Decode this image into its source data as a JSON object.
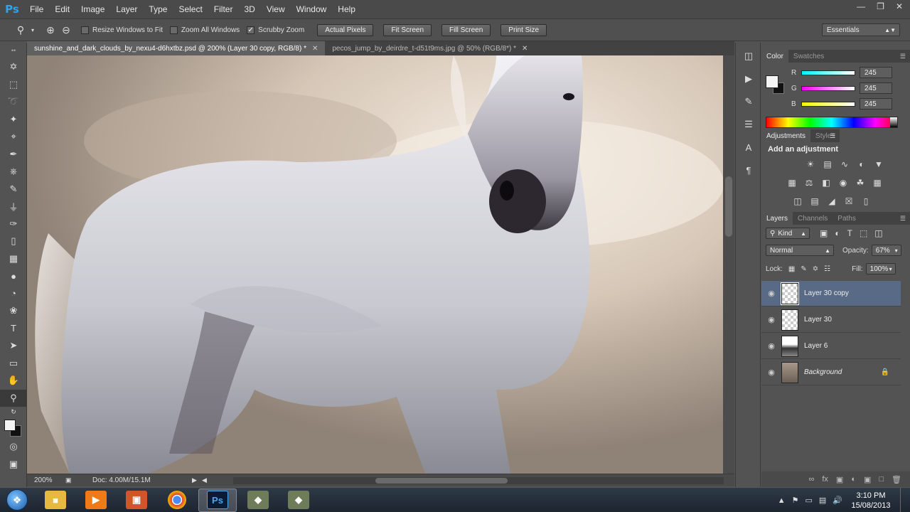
{
  "app": {
    "logo": "Ps"
  },
  "menu": [
    "File",
    "Edit",
    "Image",
    "Layer",
    "Type",
    "Select",
    "Filter",
    "3D",
    "View",
    "Window",
    "Help"
  ],
  "window_controls": [
    "minimize-icon",
    "restore-icon",
    "close-icon"
  ],
  "options": {
    "resize_windows": {
      "label": "Resize Windows to Fit",
      "checked": false
    },
    "zoom_all": {
      "label": "Zoom All Windows",
      "checked": false
    },
    "scrubby": {
      "label": "Scrubby Zoom",
      "checked": true
    },
    "buttons": [
      "Actual Pixels",
      "Fit Screen",
      "Fill Screen",
      "Print Size"
    ],
    "workspace": "Essentials"
  },
  "tabs": [
    {
      "title": "sunshine_and_dark_clouds_by_nexu4-d6hxtbz.psd @ 200% (Layer 30 copy, RGB/8) *",
      "active": true
    },
    {
      "title": "pecos_jump_by_deirdre_t-d51t9ms.jpg @ 50% (RGB/8*) *",
      "active": false
    }
  ],
  "status": {
    "zoom": "200%",
    "doc": "Doc: 4.00M/15.1M"
  },
  "color_panel": {
    "tabs": [
      "Color",
      "Swatches"
    ],
    "channels": [
      {
        "label": "R",
        "value": "245",
        "gradient": "#00ffff"
      },
      {
        "label": "G",
        "value": "245",
        "gradient": "#ff00ff"
      },
      {
        "label": "B",
        "value": "245",
        "gradient": "#ffff00"
      }
    ],
    "foreground": "#f5f5f5",
    "background": "#111111"
  },
  "adjustments_panel": {
    "tabs": [
      "Adjustments",
      "Styles"
    ],
    "title": "Add an adjustment"
  },
  "layers_panel": {
    "tabs": [
      "Layers",
      "Channels",
      "Paths"
    ],
    "filter": "Kind",
    "blend_mode": "Normal",
    "opacity_label": "Opacity:",
    "opacity": "67%",
    "lock_label": "Lock:",
    "fill_label": "Fill:",
    "fill": "100%",
    "layers": [
      {
        "name": "Layer 30 copy",
        "active": true,
        "locked": false,
        "italic": false
      },
      {
        "name": "Layer 30",
        "active": false,
        "locked": false,
        "italic": false
      },
      {
        "name": "Layer 6",
        "active": false,
        "locked": false,
        "italic": false
      },
      {
        "name": "Background",
        "active": false,
        "locked": true,
        "italic": true
      }
    ]
  },
  "taskbar": {
    "apps": [
      "file-explorer-icon",
      "media-player-icon",
      "office-icon",
      "chrome-icon",
      "photoshop-icon",
      "app-icon",
      "app-icon-2"
    ],
    "time": "3:10 PM",
    "date": "15/08/2013"
  }
}
